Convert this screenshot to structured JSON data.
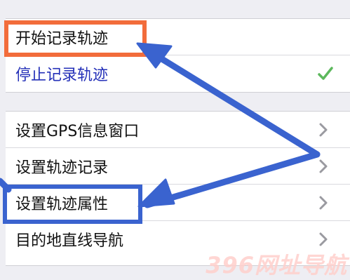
{
  "menu": {
    "group1": [
      {
        "label": "开始记录轨迹",
        "accessory": "none"
      },
      {
        "label": "停止记录轨迹",
        "accessory": "checkmark-icon"
      }
    ],
    "group2": [
      {
        "label": "设置GPS信息窗口",
        "accessory": "chevron-right-icon"
      },
      {
        "label": "设置轨迹记录",
        "accessory": "chevron-right-icon"
      },
      {
        "label": "设置轨迹属性",
        "accessory": "chevron-right-icon"
      },
      {
        "label": "目的地直线导航",
        "accessory": "chevron-right-icon"
      }
    ]
  },
  "watermark": "396网址导航",
  "colors": {
    "highlight_orange": "#f26c3b",
    "highlight_blue": "#3a63cf",
    "active_item_text": "#2430b8",
    "checkmark": "#5cb85c",
    "background": "#eeeef3"
  }
}
